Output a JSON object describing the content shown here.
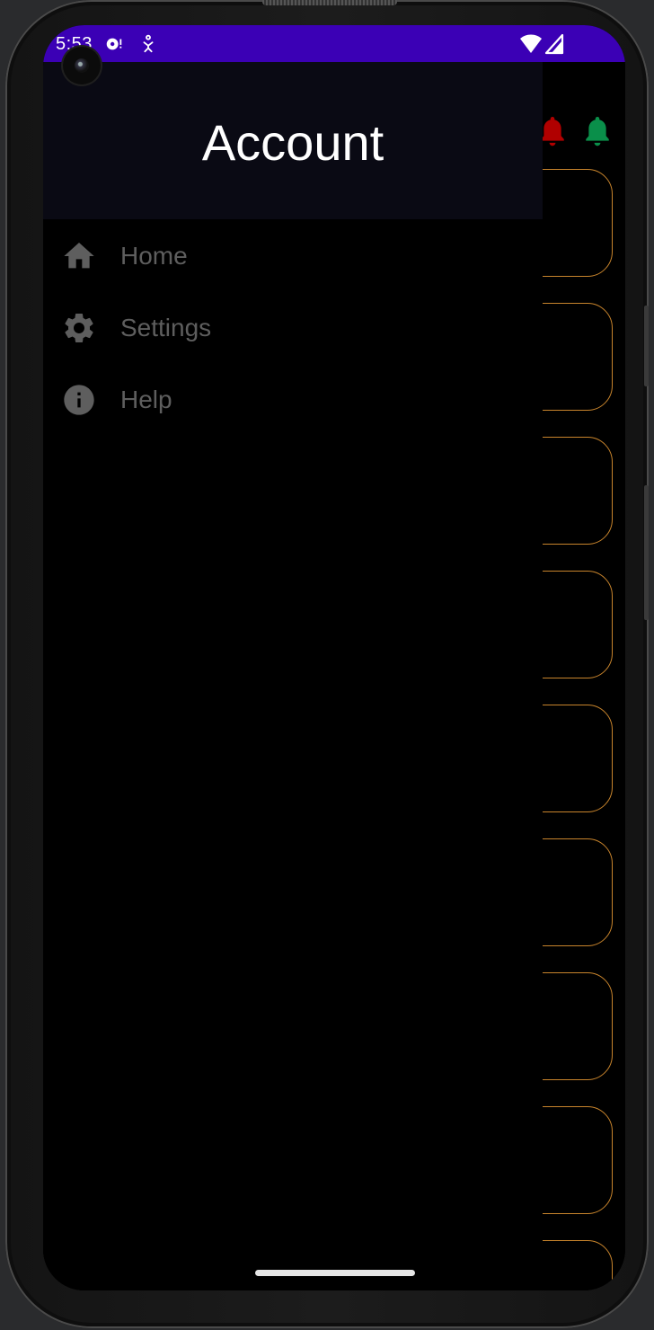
{
  "status_bar": {
    "time": "5:53",
    "background_color": "#3b00b5",
    "icons": [
      "media-icon",
      "accessibility-icon",
      "wifi-icon",
      "signal-icon"
    ]
  },
  "drawer": {
    "header_title": "Account",
    "items": [
      {
        "label": "Home",
        "icon": "home-icon"
      },
      {
        "label": "Settings",
        "icon": "gear-icon"
      },
      {
        "label": "Help",
        "icon": "info-icon"
      }
    ]
  },
  "background_app": {
    "bells": [
      {
        "name": "red-bell-icon",
        "color": "#b00000"
      },
      {
        "name": "green-bell-icon",
        "color": "#0a8f4a"
      }
    ],
    "card_border_color": "#c8842c"
  }
}
